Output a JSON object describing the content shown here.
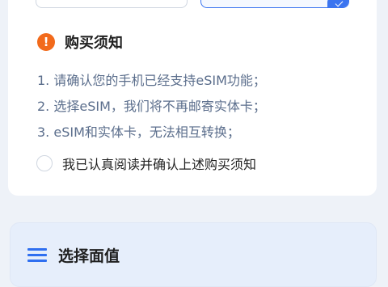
{
  "notice": {
    "icon": "exclamation-icon",
    "icon_glyph": "!",
    "icon_color": "#f26a1b",
    "title": "购买须知",
    "items": [
      "1. 请确认您的手机已经支持eSIM功能；",
      "2. 选择eSIM，我们将不再邮寄实体卡；",
      "3. eSIM和实体卡，无法相互转换；"
    ],
    "agree_label": "我已认真阅读并确认上述购买须知",
    "agree_checked": false
  },
  "denomination": {
    "icon": "list-icon",
    "title": "选择面值"
  },
  "colors": {
    "accent": "#3a74f0",
    "text_secondary": "#5b6e8c"
  }
}
